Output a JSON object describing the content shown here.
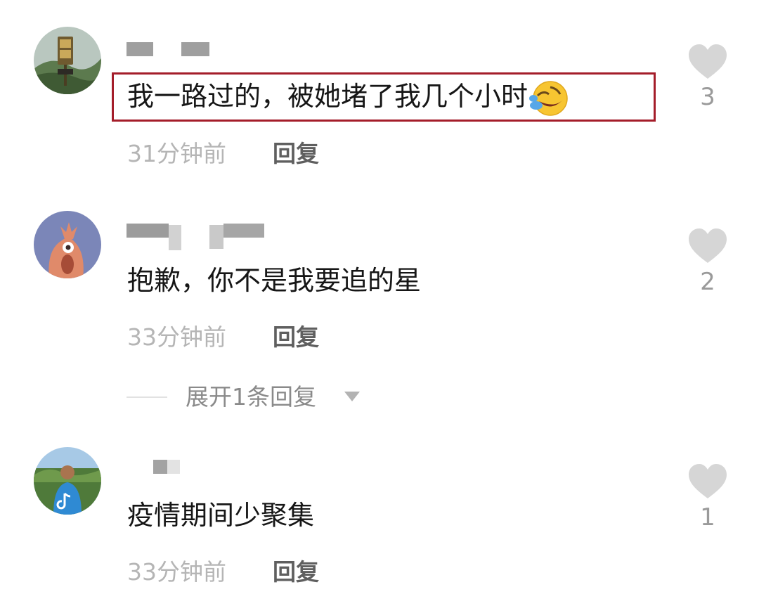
{
  "comments": [
    {
      "text": "我一路过的，被她堵了我几个小时",
      "emoji_icon": "rolling-on-floor-laughing-icon",
      "time": "31分钟前",
      "reply": "回复",
      "likes": "3",
      "highlighted": true
    },
    {
      "text": "抱歉，你不是我要追的星",
      "time": "33分钟前",
      "reply": "回复",
      "likes": "2"
    },
    {
      "text": "疫情期间少聚集",
      "time": "33分钟前",
      "reply": "回复",
      "likes": "1"
    }
  ],
  "expand_replies": {
    "label": "展开1条回复"
  },
  "colors": {
    "highlight_border": "#a41d2a",
    "time_text": "#b5b5b5",
    "reply_text": "#5f5f5f",
    "heart": "#d6d6d6",
    "like_count": "#9a9a9a"
  },
  "icons": {
    "like": "heart-icon",
    "expand": "caret-down-icon"
  }
}
